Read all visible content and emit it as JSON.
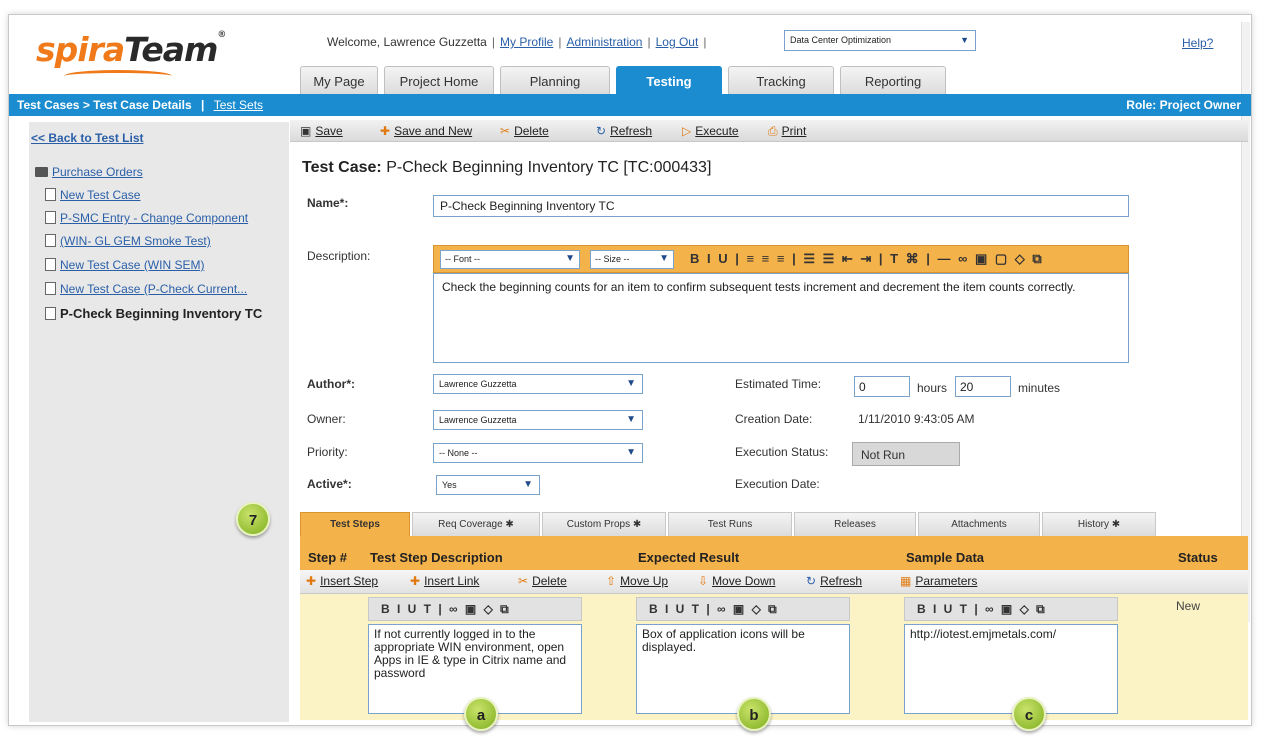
{
  "app": {
    "logo_spira": "spira",
    "logo_team": "Team",
    "logo_tm": "®"
  },
  "header": {
    "welcome": "Welcome, Lawrence Guzzetta",
    "sep": "|",
    "my_profile": "My Profile",
    "administration": "Administration",
    "log_out": "Log Out",
    "project": "Data Center Optimization",
    "help": "Help?"
  },
  "main_tabs": [
    {
      "label": "My Page"
    },
    {
      "label": "Project Home"
    },
    {
      "label": "Planning"
    },
    {
      "label": "Testing"
    },
    {
      "label": "Tracking"
    },
    {
      "label": "Reporting"
    }
  ],
  "breadcrumb": {
    "path": "Test Cases > Test Case Details",
    "sep": "|",
    "test_sets": "Test Sets",
    "role": "Role: Project Owner"
  },
  "sidebar": {
    "back": "<< Back to Test List",
    "folder": "Purchase Orders",
    "items": [
      "New Test Case",
      "P-SMC Entry - Change Component",
      "(WIN- GL GEM Smoke Test)",
      "New Test Case (WIN SEM)",
      "New Test Case (P-Check Current...",
      "P-Check Beginning Inventory TC"
    ],
    "callout": "7"
  },
  "toolbar": {
    "save": "Save",
    "save_and_new": "Save and New",
    "delete": "Delete",
    "refresh": "Refresh",
    "execute": "Execute",
    "print": "Print"
  },
  "form": {
    "title_prefix": "Test Case:",
    "title": "P-Check Beginning Inventory TC [TC:000433]",
    "name_label": "Name*:",
    "name_value": "P-Check Beginning Inventory TC",
    "description_label": "Description:",
    "font_dd": "-- Font --",
    "size_dd": "-- Size --",
    "rte_glyphs": "B I U | ≡ ≡ ≡ | ☰ ☰ ⇤ ⇥ | T ⌘ | — ∞ ▣ ▢ ◇ ⧉",
    "description": "Check the beginning counts for an item to confirm subsequent tests increment and decrement the item counts correctly.",
    "author_label": "Author*:",
    "author": "Lawrence Guzzetta",
    "owner_label": "Owner:",
    "owner": "Lawrence Guzzetta",
    "priority_label": "Priority:",
    "priority": "-- None --",
    "active_label": "Active*:",
    "active": "Yes",
    "est_time_label": "Estimated Time:",
    "hours": "0",
    "hours_label": "hours",
    "minutes": "20",
    "minutes_label": "minutes",
    "creation_label": "Creation Date:",
    "creation_date": "1/11/2010 9:43:05 AM",
    "exec_status_label": "Execution Status:",
    "exec_status": "Not Run",
    "exec_date_label": "Execution Date:"
  },
  "detail_tabs": [
    "Test Steps",
    "Req Coverage ✱",
    "Custom Props ✱",
    "Test Runs",
    "Releases",
    "Attachments",
    "History ✱"
  ],
  "steps": {
    "col_step": "Step #",
    "col_desc": "Test Step Description",
    "col_expected": "Expected Result",
    "col_sample": "Sample Data",
    "col_status": "Status",
    "insert_step": "Insert Step",
    "insert_link": "Insert Link",
    "delete": "Delete",
    "move_up": "Move Up",
    "move_down": "Move Down",
    "refresh": "Refresh",
    "parameters": "Parameters",
    "mini_rte_a": "B I U T | ∞ ▣ ◇ ⧉",
    "mini_rte_b": "B I U T | ∞ ▣ ◇ ⧉",
    "mini_rte_c": "B I U T | ∞ ▣ ◇ ⧉",
    "description": "If not currently logged in to the appropriate WIN environment, open Apps in IE & type in Citrix name and password",
    "expected": "Box of application icons will be displayed.",
    "sample": "http://iotest.emjmetals.com/",
    "status": "New",
    "callout_a": "a",
    "callout_b": "b",
    "callout_c": "c"
  }
}
